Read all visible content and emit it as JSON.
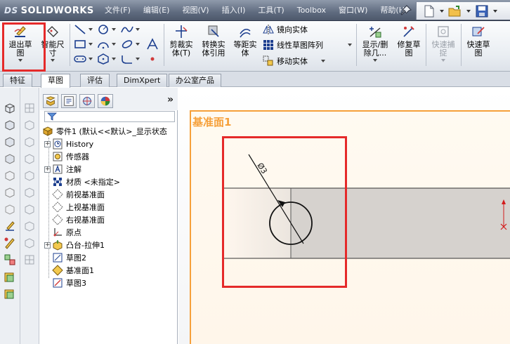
{
  "app": {
    "logo_prefix": "DS",
    "logo_text": "SOLIDWORKS"
  },
  "menu": [
    {
      "label": "文件(F)"
    },
    {
      "label": "编辑(E)"
    },
    {
      "label": "视图(V)"
    },
    {
      "label": "插入(I)"
    },
    {
      "label": "工具(T)"
    },
    {
      "label": "Toolbox"
    },
    {
      "label": "窗口(W)"
    },
    {
      "label": "帮助(H)"
    }
  ],
  "quick_access": [
    "new-document-icon",
    "open-folder-icon",
    "save-icon"
  ],
  "ribbon": {
    "exit_sketch": "退出草\n图",
    "smart_dimension": "智能尺\n寸",
    "trim_entities": "剪裁实\n体(T)",
    "convert_entities": "转换实\n体引用",
    "offset_entities": "等距实\n体",
    "mirror_entities": "镜向实体",
    "linear_pattern": "线性草图阵列",
    "move_entities": "移动实体",
    "display_delete_relations": "显示/删\n除几...",
    "repair_sketch": "修复草\n图",
    "quick_snaps": "快速捕\n捉",
    "rapid_sketch": "快速草\n图"
  },
  "tabs": [
    {
      "label": "特征",
      "active": false
    },
    {
      "label": "草图",
      "active": true
    },
    {
      "label": "评估",
      "active": false
    },
    {
      "label": "DimXpert",
      "active": false
    },
    {
      "label": "办公室产品",
      "active": false
    }
  ],
  "feature_tree": {
    "root": "零件1  (默认<<默认>_显示状态",
    "items": [
      {
        "label": "History",
        "expandable": true,
        "icon": "history-icon"
      },
      {
        "label": "传感器",
        "expandable": false,
        "icon": "sensor-icon"
      },
      {
        "label": "注解",
        "expandable": true,
        "icon": "annotation-icon"
      },
      {
        "label": "材质 <未指定>",
        "expandable": false,
        "icon": "material-icon"
      },
      {
        "label": "前视基准面",
        "expandable": false,
        "icon": "plane-icon"
      },
      {
        "label": "上视基准面",
        "expandable": false,
        "icon": "plane-icon"
      },
      {
        "label": "右视基准面",
        "expandable": false,
        "icon": "plane-icon"
      },
      {
        "label": "原点",
        "expandable": false,
        "icon": "origin-icon"
      },
      {
        "label": "凸台-拉伸1",
        "expandable": true,
        "icon": "extrude-icon"
      },
      {
        "label": "草图2",
        "expandable": false,
        "icon": "sketch-icon"
      },
      {
        "label": "基准面1",
        "expandable": false,
        "icon": "plane-icon"
      },
      {
        "label": "草图3",
        "expandable": false,
        "icon": "sketch-active-icon"
      }
    ]
  },
  "graphics": {
    "plane_label": "基准面1",
    "dimension_text": "Ø3"
  },
  "colors": {
    "highlight_red": "#e52a2a",
    "plane_orange": "#f6a03a",
    "body_gray": "#d6d2ce"
  }
}
